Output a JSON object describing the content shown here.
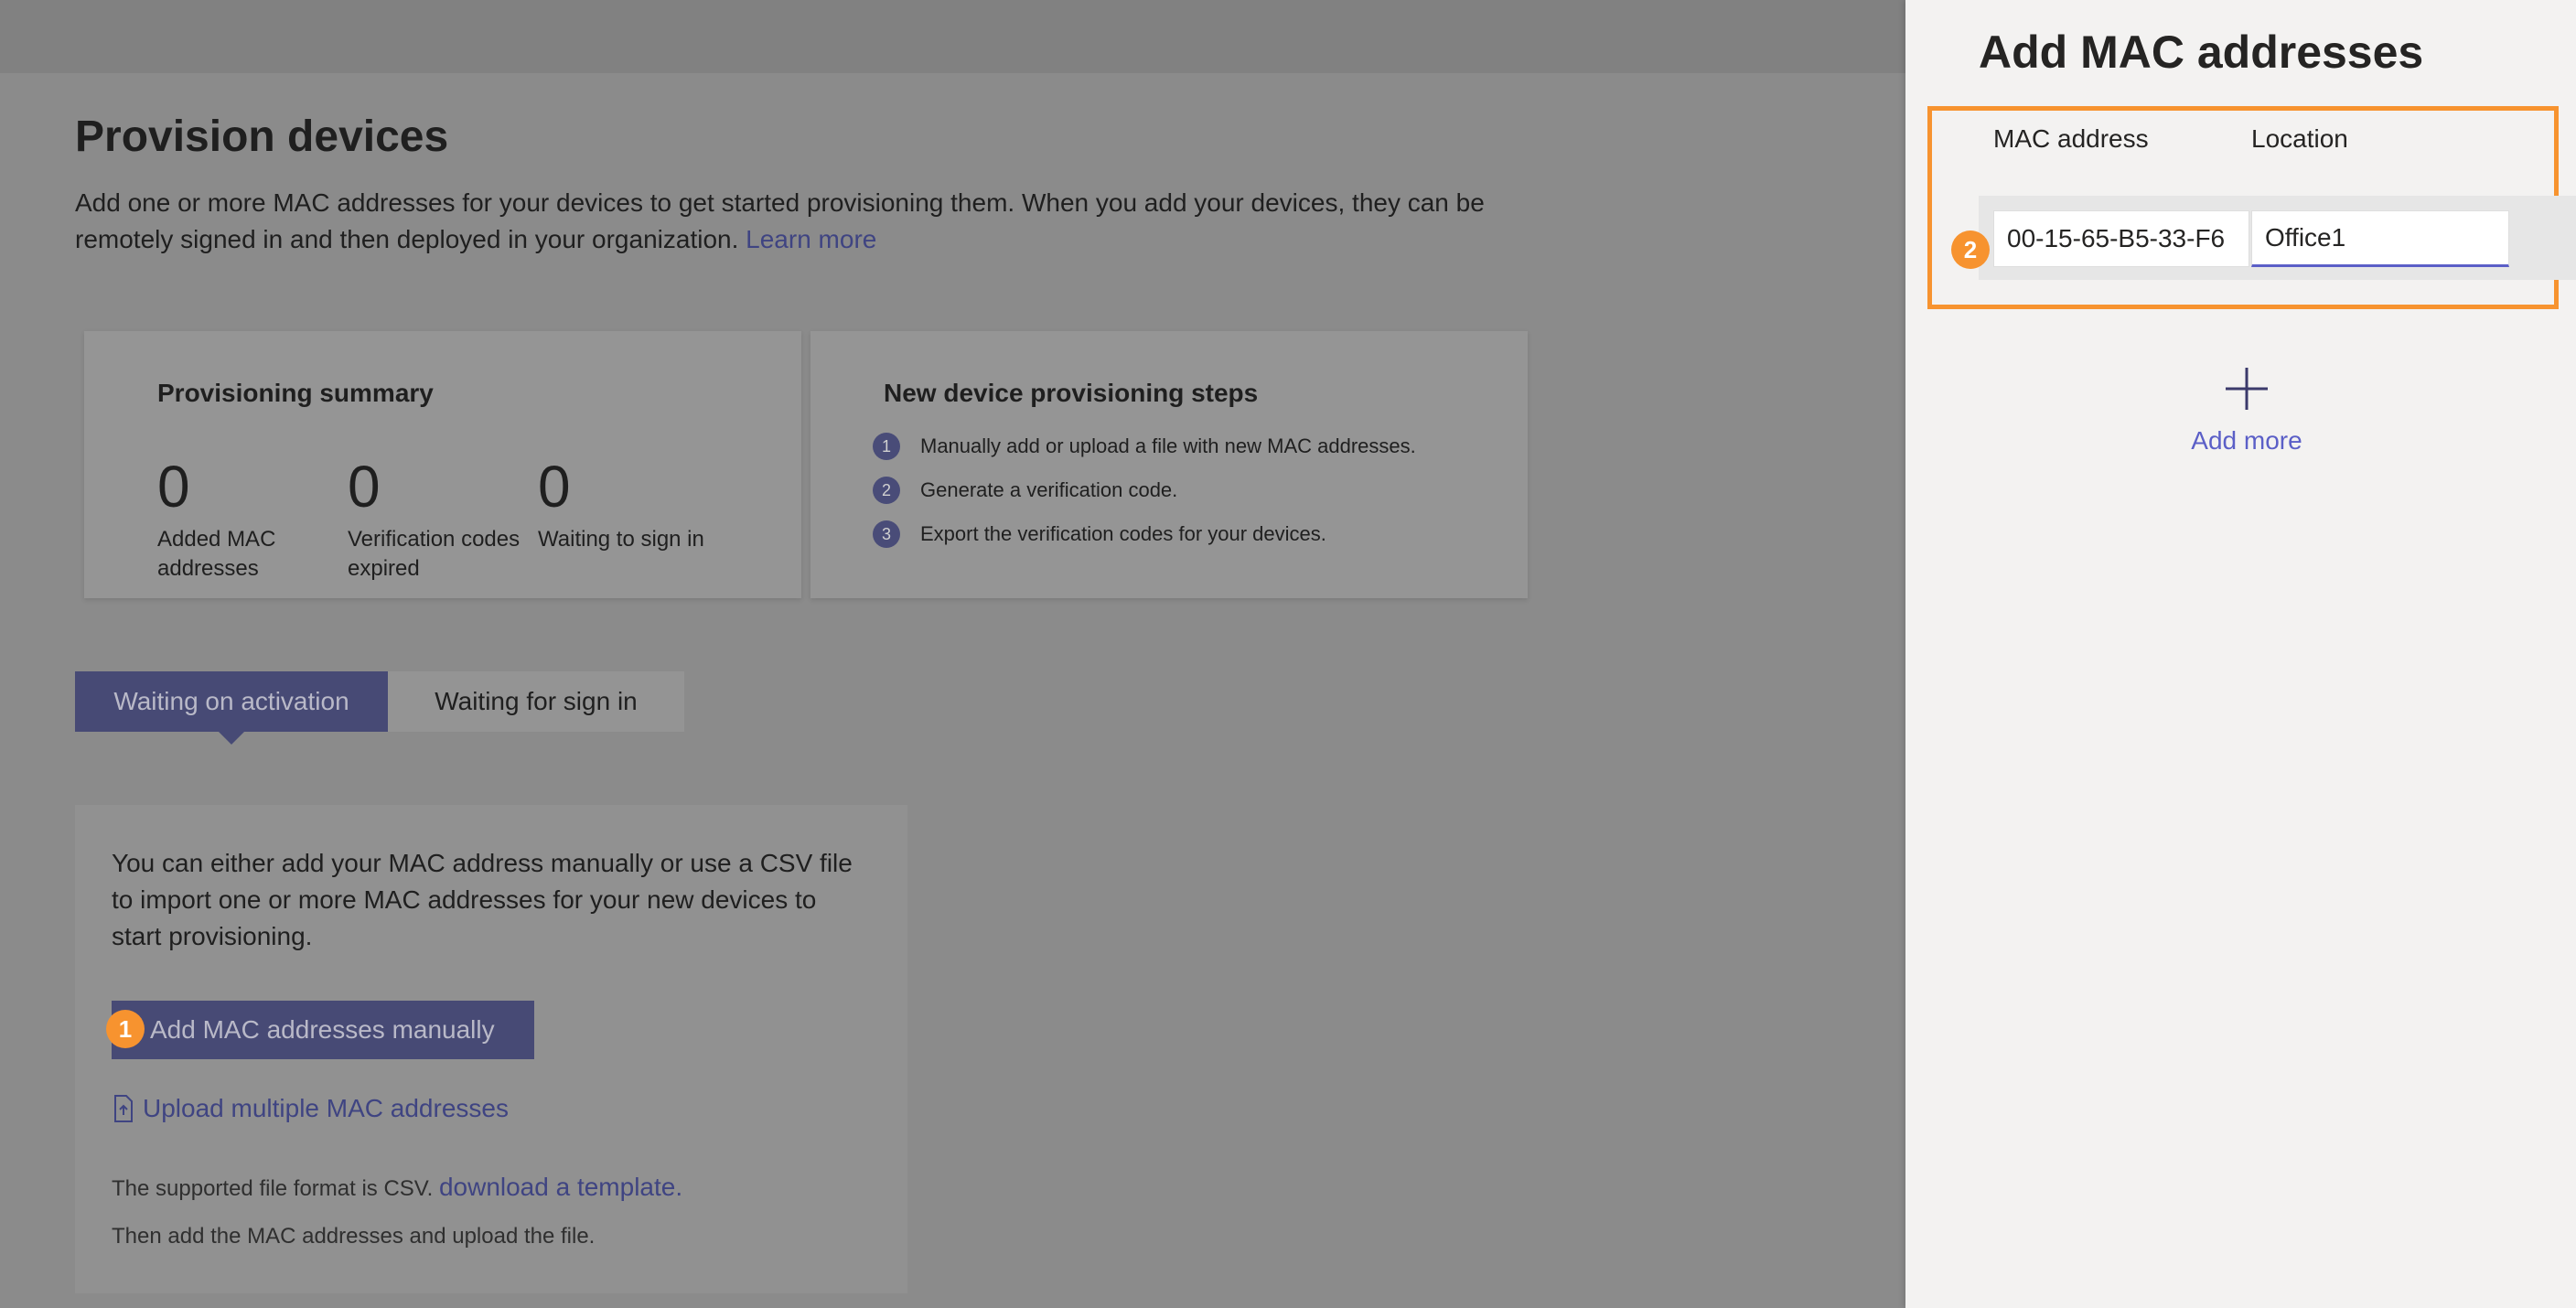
{
  "main": {
    "title": "Provision devices",
    "intro_text": "Add one or more MAC addresses for your devices to get started provisioning them. When you add your devices, they can be remotely signed in and then deployed in your organization.",
    "learn_more": "Learn more",
    "summary": {
      "title": "Provisioning summary",
      "stats": [
        {
          "value": "0",
          "label": "Added MAC addresses"
        },
        {
          "value": "0",
          "label": "Verification codes expired"
        },
        {
          "value": "0",
          "label": "Waiting to sign in"
        }
      ]
    },
    "steps": {
      "title": "New device provisioning steps",
      "items": [
        {
          "num": "1",
          "text": "Manually add or upload a file with new MAC addresses."
        },
        {
          "num": "2",
          "text": "Generate a verification code."
        },
        {
          "num": "3",
          "text": "Export the verification codes for your devices."
        }
      ]
    },
    "tabs": [
      {
        "label": "Waiting on activation",
        "selected": true
      },
      {
        "label": "Waiting for sign in",
        "selected": false
      }
    ],
    "panel": {
      "description": "You can either add your MAC address manually or use a CSV file to import one or more MAC addresses for your new devices to start provisioning.",
      "add_manually_label": "Add MAC addresses manually",
      "upload_label": "Upload multiple MAC addresses",
      "format_note": "The supported file format is CSV.",
      "download_template": "download a template.",
      "then_note": "Then add the MAC addresses and upload the file."
    }
  },
  "side_panel": {
    "title": "Add MAC addresses",
    "columns": {
      "mac": "MAC address",
      "location": "Location"
    },
    "row": {
      "mac_value": "00-15-65-B5-33-F6",
      "location_value": "Office1"
    },
    "add_more_label": "Add more"
  },
  "callouts": [
    "1",
    "2"
  ],
  "colors": {
    "accent": "#5b5fc7",
    "callout": "#f7932f",
    "overlay": "#8b8b8b",
    "panel_bg": "#f3f2f1"
  }
}
